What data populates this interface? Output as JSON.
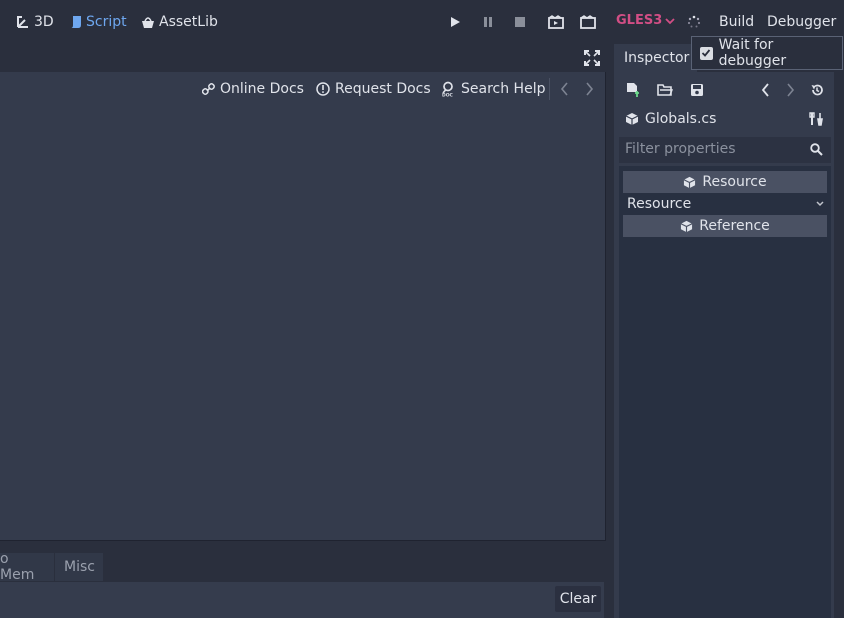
{
  "top_tabs": [
    {
      "label": "3D",
      "icon": "3d-transform-icon"
    },
    {
      "label": "Script",
      "icon": "script-icon",
      "active": true
    },
    {
      "label": "AssetLib",
      "icon": "assetlib-icon"
    }
  ],
  "renderer": "GLES3",
  "menus": {
    "build": "Build",
    "debugger": "Debugger"
  },
  "popup": {
    "wait_for_debugger": "Wait for debugger",
    "checked": true
  },
  "editor": {
    "online_docs": "Online Docs",
    "request_docs": "Request Docs",
    "search_help": "Search Help"
  },
  "bottom_panel": {
    "tabs": [
      "o Mem",
      "Misc"
    ],
    "clear_label": "Clear"
  },
  "inspector": {
    "tab_label": "Inspector",
    "object_name": "Globals.cs",
    "filter_placeholder": "Filter properties",
    "sections": {
      "resource": "Resource",
      "reference": "Reference"
    },
    "resource_row": "Resource"
  },
  "colors": {
    "accent": "#6ea7ef",
    "renderer": "#d24e85",
    "background": "#2a2f3d",
    "panel": "#343b4c"
  }
}
